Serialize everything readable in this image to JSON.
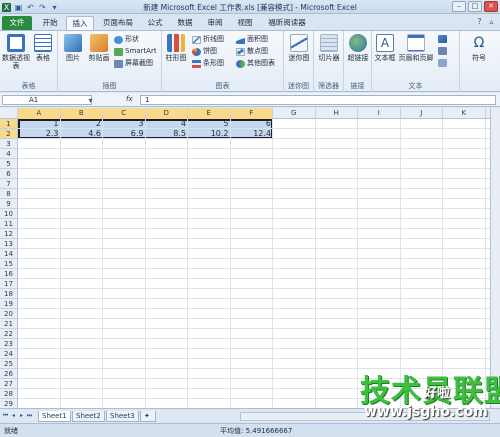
{
  "window": {
    "title": "新建 Microsoft Excel 工作表.xls  [兼容模式] - Microsoft Excel",
    "minimize": "–",
    "maximize": "□",
    "close": "✕"
  },
  "tabs": [
    "文件",
    "开始",
    "插入",
    "页面布局",
    "公式",
    "数据",
    "审阅",
    "视图",
    "福昕阅读器"
  ],
  "active_tab": "插入",
  "ribbon": {
    "groups": {
      "tables": "表格",
      "illustrations": "插图",
      "charts": "图表",
      "sparklines": "迷你图",
      "filter": "筛选器",
      "links": "链接",
      "text": "文本"
    },
    "buttons": {
      "pivot": "数据透视表",
      "table": "表格",
      "picture": "图片",
      "clipart": "剪贴画",
      "shapes": "形状",
      "smartart": "SmartArt",
      "screenshot": "屏幕截图",
      "column": "柱形图",
      "line": "折线图",
      "pie": "饼图",
      "bar": "条形图",
      "area": "面积图",
      "scatter": "散点图",
      "other": "其他图表",
      "sparkline": "迷你图",
      "slicer": "切片器",
      "hyperlink": "超链接",
      "textbox": "文本框",
      "header_footer": "页眉和页脚",
      "symbol": "符号"
    }
  },
  "formula_bar": {
    "name_box": "A1",
    "fx": "fx",
    "content": "1"
  },
  "columns": [
    "A",
    "B",
    "C",
    "D",
    "E",
    "F",
    "G",
    "H",
    "I",
    "J",
    "K"
  ],
  "rows": [
    "1",
    "2",
    "3",
    "4",
    "5",
    "6",
    "7",
    "8",
    "9",
    "10",
    "11",
    "12",
    "13",
    "14",
    "15",
    "16",
    "17",
    "18",
    "19",
    "20",
    "21",
    "22",
    "23",
    "24",
    "25",
    "26",
    "27",
    "28",
    "29"
  ],
  "cells": {
    "row1": [
      "1",
      "2",
      "3",
      "4",
      "5",
      "6"
    ],
    "row2": [
      "2.3",
      "4.6",
      "6.9",
      "8.5",
      "10.2",
      "12.4"
    ]
  },
  "sheets": [
    "Sheet1",
    "Sheet2",
    "Sheet3"
  ],
  "active_sheet": "Sheet1",
  "status": {
    "ready": "就绪",
    "average": "平均值: 5.491666667"
  },
  "watermark": {
    "main": "技术员联盟",
    "side": "好啦",
    "sub": "www.jsgho.com"
  },
  "colors": {
    "file_tab": "#2a8a3e",
    "selection_fill": "#c5d8ef",
    "header_highlight": "#f9d98c",
    "watermark_green": "#3fbf3f"
  }
}
